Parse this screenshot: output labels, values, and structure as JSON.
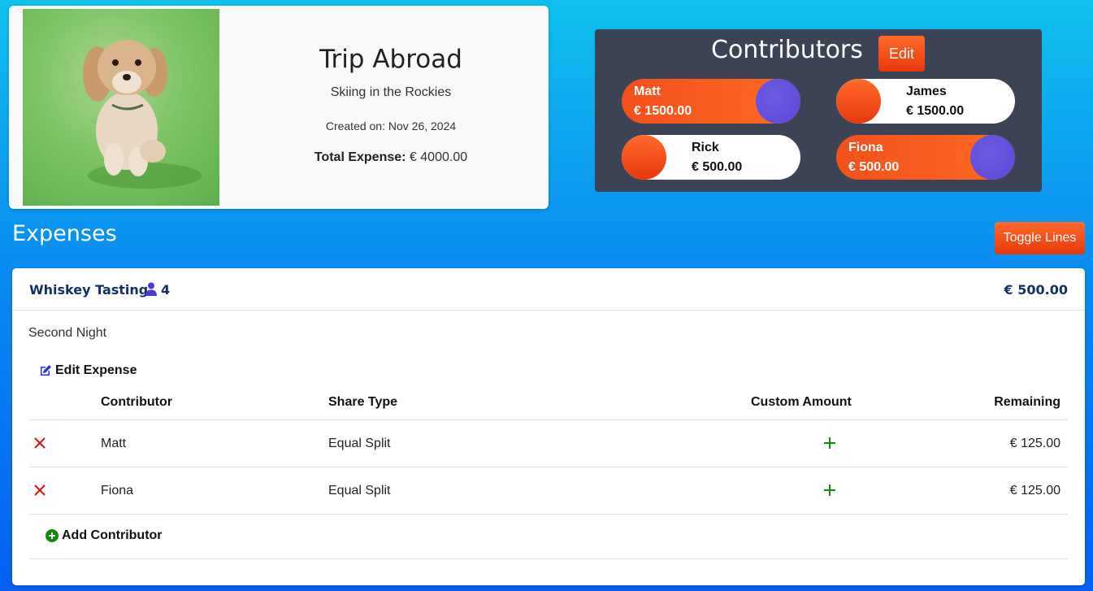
{
  "trip": {
    "title": "Trip Abroad",
    "subtitle": "Skiing in the Rockies",
    "created": "Created on: Nov 26, 2024",
    "total_label": "Total Expense:",
    "total_value": "€ 4000.00"
  },
  "contributors": {
    "title": "Contributors",
    "edit_label": "Edit",
    "items": [
      {
        "name": "Matt",
        "amount": "€ 1500.00",
        "style": "filled"
      },
      {
        "name": "James",
        "amount": "€ 1500.00",
        "style": "empty"
      },
      {
        "name": "Rick",
        "amount": "€ 500.00",
        "style": "empty"
      },
      {
        "name": "Fiona",
        "amount": "€ 500.00",
        "style": "filled"
      }
    ]
  },
  "expenses": {
    "title": "Expenses",
    "toggle_label": "Toggle Lines",
    "items": [
      {
        "name": "Whiskey Tasting",
        "people_count": "4",
        "amount": "€ 500.00",
        "description": "Second Night",
        "edit_label": "Edit Expense",
        "columns": [
          "Contributor",
          "Share Type",
          "Custom Amount",
          "Remaining"
        ],
        "rows": [
          {
            "contributor": "Matt",
            "share_type": "Equal Split",
            "remaining": "€ 125.00"
          },
          {
            "contributor": "Fiona",
            "share_type": "Equal Split",
            "remaining": "€ 125.00"
          }
        ],
        "add_label": "Add Contributor"
      }
    ]
  },
  "colors": {
    "accent_orange": "#f2501b",
    "contributor_circle": "#5b47d8",
    "navy_text": "#13306b",
    "panel_dark": "#3b4354",
    "delete_red": "#e01010",
    "add_green": "#128a12"
  }
}
